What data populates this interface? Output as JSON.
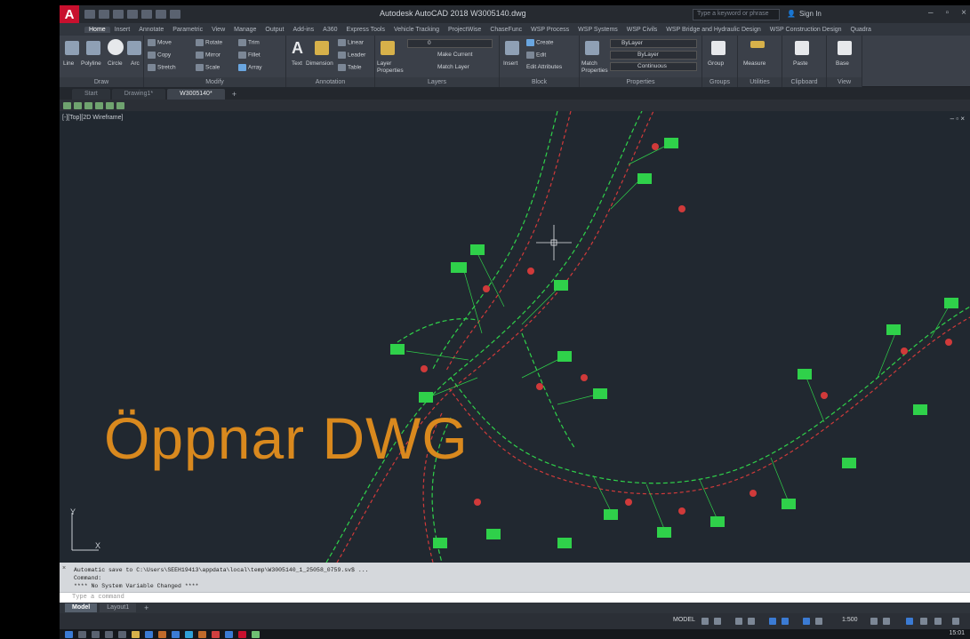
{
  "window": {
    "title": "Autodesk AutoCAD 2018   W3005140.dwg",
    "search_placeholder": "Type a keyword or phrase",
    "signin": "Sign In"
  },
  "ribbon_tabs": [
    "Home",
    "Insert",
    "Annotate",
    "Parametric",
    "View",
    "Manage",
    "Output",
    "Add-ins",
    "A360",
    "Express Tools",
    "Vehicle Tracking",
    "ProjectWise",
    "ChaseFunc",
    "WSP Process",
    "WSP Systems",
    "WSP Civils",
    "WSP Bridge and Hydraulic Design",
    "WSP Construction Design",
    "Quadra"
  ],
  "ribbon": {
    "draw": {
      "label": "Draw",
      "line": "Line",
      "polyline": "Polyline",
      "circle": "Circle",
      "arc": "Arc"
    },
    "modify": {
      "label": "Modify",
      "move": "Move",
      "rotate": "Rotate",
      "trim": "Trim",
      "copy": "Copy",
      "mirror": "Mirror",
      "fillet": "Fillet",
      "stretch": "Stretch",
      "scale": "Scale",
      "array": "Array"
    },
    "annotation": {
      "label": "Annotation",
      "text": "Text",
      "dimension": "Dimension",
      "linear": "Linear",
      "leader": "Leader",
      "table": "Table"
    },
    "layers": {
      "label": "Layers",
      "layer_props": "Layer Properties",
      "make_current": "Make Current",
      "match_layer": "Match Layer",
      "layer_value": "0"
    },
    "block": {
      "label": "Block",
      "insert": "Insert",
      "create": "Create",
      "edit": "Edit",
      "edit_attributes": "Edit Attributes"
    },
    "properties": {
      "label": "Properties",
      "match": "Match Properties",
      "bylayer": "ByLayer",
      "bylayer2": "ByLayer",
      "continuous": "Continuous"
    },
    "groups": {
      "label": "Groups",
      "group": "Group"
    },
    "utilities": {
      "label": "Utilities",
      "measure": "Measure"
    },
    "clipboard": {
      "label": "Clipboard",
      "paste": "Paste"
    },
    "view": {
      "label": "View",
      "base": "Base"
    }
  },
  "file_tabs": [
    "Start",
    "Drawing1*",
    "W3005140*"
  ],
  "viewport": {
    "label": "[-][Top][2D Wireframe]",
    "controls": "– ▫ ×",
    "overlay": "Öppnar DWG",
    "ucs_x": "X",
    "ucs_y": "Y"
  },
  "command_history": [
    "Automatic save to C:\\Users\\SEEH19413\\appdata\\local\\temp\\W3005140_1_25058_0759.sv$ ...",
    "Command:",
    "**** No System Variable Changed ****"
  ],
  "command_prompt": "Type a command",
  "layout_tabs": [
    "Model",
    "Layout1"
  ],
  "status": {
    "model": "MODEL",
    "scale": "1:500"
  },
  "taskbar": {
    "clock": "15:01"
  },
  "colors": {
    "background": "#212830",
    "lines_green": "#2fd14a",
    "lines_red": "#d03a3a",
    "overlay": "#d9891e"
  }
}
